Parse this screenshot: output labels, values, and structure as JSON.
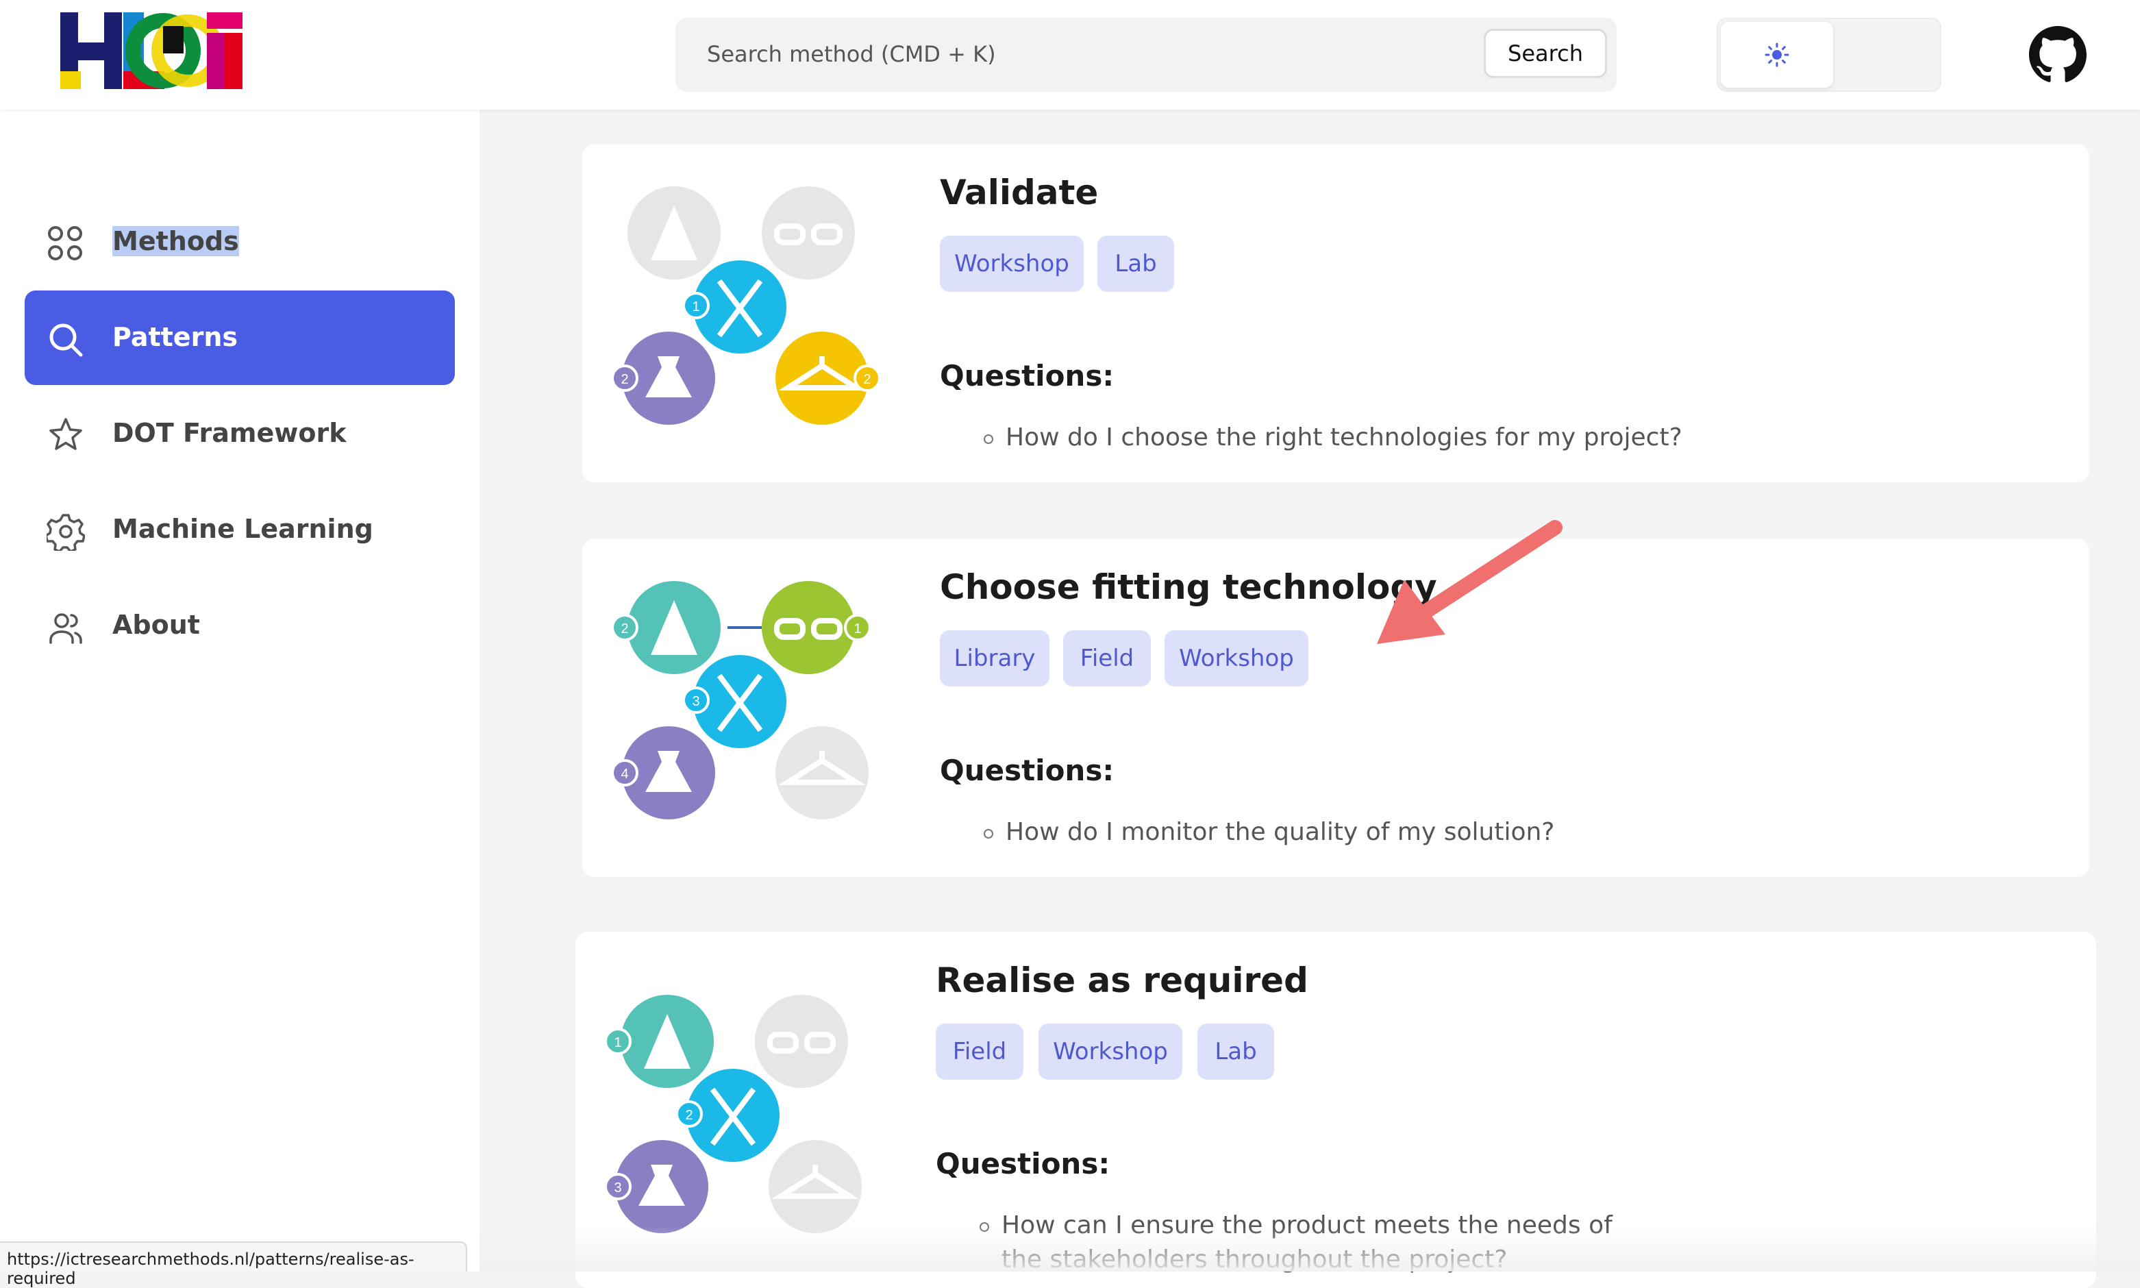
{
  "header": {
    "logo_alt": "HBO-ICT",
    "search": {
      "placeholder": "Search method (CMD + K)",
      "button": "Search"
    },
    "theme": {
      "light_icon": "sun-icon"
    },
    "github_icon": "github-icon"
  },
  "sidebar": {
    "items": [
      {
        "label": "Methods",
        "icon": "grid-icon"
      },
      {
        "label": "Patterns",
        "icon": "search-icon",
        "active": true
      },
      {
        "label": "DOT Framework",
        "icon": "star-icon"
      },
      {
        "label": "Machine Learning",
        "icon": "gear-icon"
      },
      {
        "label": "About",
        "icon": "users-icon"
      }
    ]
  },
  "cards": [
    {
      "title": "Validate",
      "tags": [
        "Workshop",
        "Lab"
      ],
      "questions_label": "Questions:",
      "questions": [
        "How do I choose the right technologies for my project?"
      ]
    },
    {
      "title": "Choose fitting technology",
      "tags": [
        "Library",
        "Field",
        "Workshop"
      ],
      "questions_label": "Questions:",
      "questions": [
        "How do I monitor the quality of my solution?"
      ]
    },
    {
      "title": "Realise as required",
      "tags": [
        "Field",
        "Workshop",
        "Lab"
      ],
      "questions_label": "Questions:",
      "questions": [
        "How can I ensure the product meets the needs of the stakeholders throughout the project?"
      ]
    }
  ],
  "status_url": "https://ictresearchmethods.nl/patterns/realise-as-required",
  "colors": {
    "accent": "#4a5be4",
    "tag_bg": "#dde0fb",
    "tag_text": "#4e58cf",
    "annotation_arrow": "#f07070"
  }
}
